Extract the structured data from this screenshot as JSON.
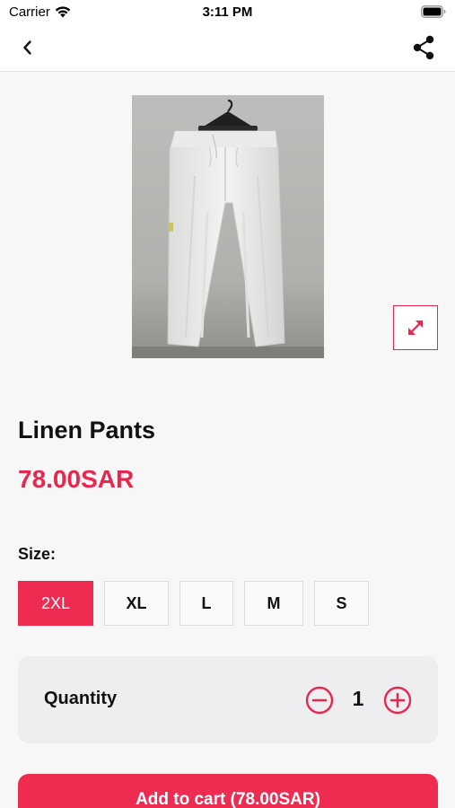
{
  "status_bar": {
    "carrier": "Carrier",
    "time": "3:11 PM",
    "wifi_icon": "wifi-icon",
    "battery_icon": "battery-icon"
  },
  "nav": {
    "back_icon": "chevron-left-icon",
    "share_icon": "share-icon"
  },
  "product": {
    "image_icon": "white-linen-pants-on-hanger",
    "expand_icon": "expand-arrows-icon",
    "title": "Linen Pants",
    "price": "78.00SAR"
  },
  "size": {
    "label": "Size:",
    "options": [
      "2XL",
      "XL",
      "L",
      "M",
      "S"
    ],
    "selected": "2XL"
  },
  "quantity": {
    "label": "Quantity",
    "value": "1",
    "minus_icon": "minus-circle-icon",
    "plus_icon": "plus-circle-icon"
  },
  "cart": {
    "button_label": "Add to cart (78.00SAR)"
  },
  "colors": {
    "accent": "#ee2b50",
    "price": "#e8274f",
    "background": "#f7f7f7",
    "card": "#eeeef0"
  }
}
